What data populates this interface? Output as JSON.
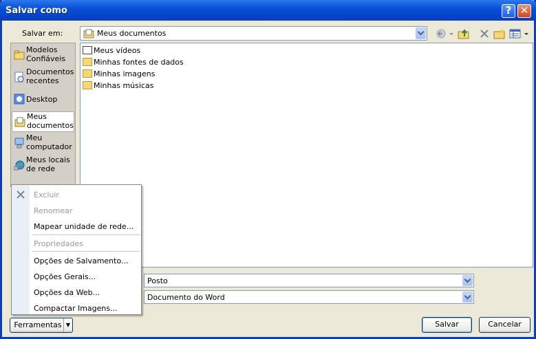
{
  "window": {
    "title": "Salvar como"
  },
  "lookin": {
    "label": "Salvar em:",
    "value": "Meus documentos"
  },
  "places": [
    {
      "label": "Modelos Confiáveis",
      "icon": "folder-icon"
    },
    {
      "label": "Documentos recentes",
      "icon": "recent-documents-icon"
    },
    {
      "label": "Desktop",
      "icon": "desktop-icon"
    },
    {
      "label": "Meus documentos",
      "icon": "my-documents-icon",
      "selected": true
    },
    {
      "label": "Meu computador",
      "icon": "my-computer-icon"
    },
    {
      "label": "Meus locais de rede",
      "icon": "network-places-icon"
    }
  ],
  "files": [
    {
      "name": "Meus vídeos",
      "icon": "videos-folder-icon"
    },
    {
      "name": "Minhas fontes de dados",
      "icon": "data-sources-folder-icon"
    },
    {
      "name": "Minhas imagens",
      "icon": "pictures-folder-icon"
    },
    {
      "name": "Minhas músicas",
      "icon": "music-folder-icon"
    }
  ],
  "menu": {
    "items": [
      {
        "label": "Excluir",
        "disabled": true
      },
      {
        "label": "Renomear",
        "disabled": true
      },
      {
        "label": "Mapear unidade de rede...",
        "disabled": false
      },
      {
        "label": "Propriedades",
        "disabled": true
      },
      {
        "label": "Opções de Salvamento...",
        "disabled": false
      },
      {
        "label": "Opções Gerais...",
        "disabled": false
      },
      {
        "label": "Opções da Web...",
        "disabled": false
      },
      {
        "label": "Compactar Imagens...",
        "disabled": false
      }
    ]
  },
  "filename": {
    "value": "Posto"
  },
  "filetype": {
    "value": "Documento do Word"
  },
  "buttons": {
    "tools": "Ferramentas",
    "save": "Salvar",
    "cancel": "Cancelar"
  }
}
